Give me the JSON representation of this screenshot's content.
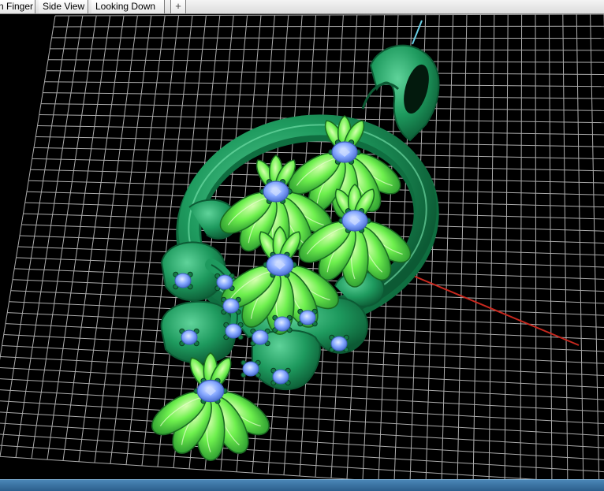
{
  "tabs": [
    {
      "label": "n Finger"
    },
    {
      "label": "Side View"
    },
    {
      "label": "Looking Down"
    }
  ],
  "add_tab_glyph": "+",
  "viewport": {
    "grid_color": "#d8d8d8",
    "background": "#000000",
    "model_colors": {
      "metal": "#1e9a5e",
      "petal": "#5fe04a",
      "stone": "#7fa4ff",
      "prong": "#157a45"
    },
    "axis_colors": {
      "x_axis": "#c8281e",
      "z_axis": "#6ad0e6"
    }
  }
}
